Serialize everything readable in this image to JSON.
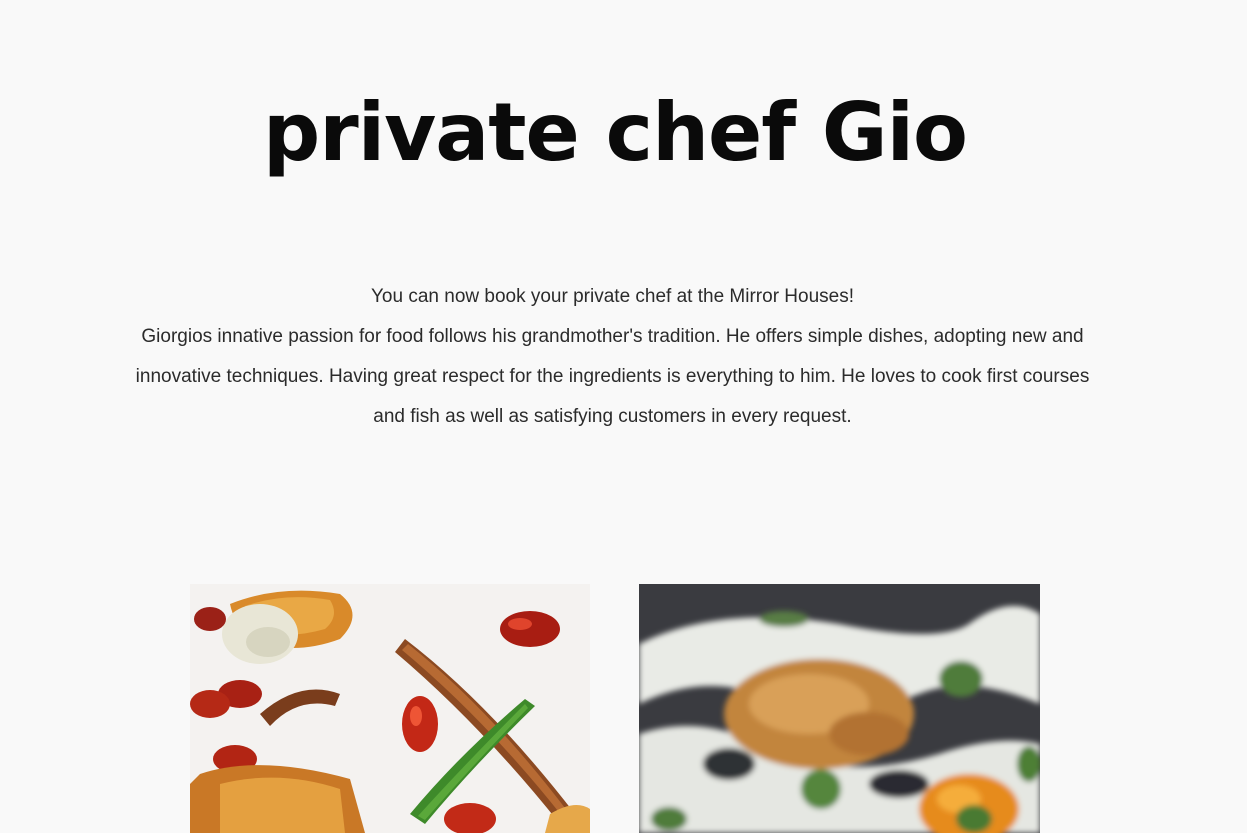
{
  "page": {
    "title": "private chef Gio",
    "intro_line_1": "You can now book your private chef at the Mirror Houses!",
    "intro_line_2": "Giorgios innative passion for food follows his grandmother's tradition. He offers simple dishes, adopting new and innovative techniques. Having great respect for the ingredients is everything to him. He loves to cook first courses and fish as well as satisfying customers in every request."
  },
  "gallery": {
    "images": [
      {
        "icon": "food-photo-anchovies",
        "background": "#f4f2f0"
      },
      {
        "icon": "food-photo-egg-dish",
        "background": "#3a3b40"
      }
    ]
  },
  "colors": {
    "background": "#f9f9f9",
    "title": "#0a0a0a",
    "body_text": "#2b2b2b"
  }
}
